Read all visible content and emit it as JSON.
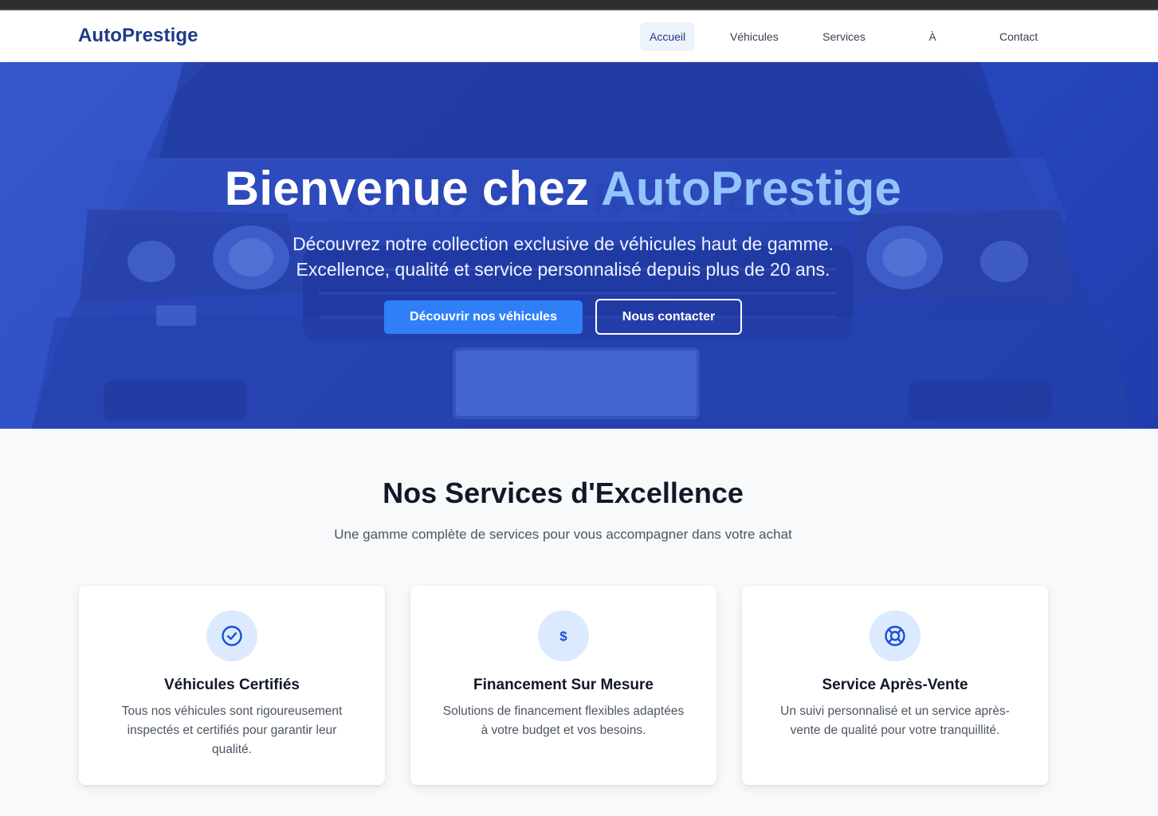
{
  "nav": {
    "brand": "AutoPrestige",
    "items": [
      {
        "label": "Accueil",
        "active": true
      },
      {
        "label": "Véhicules",
        "active": false
      },
      {
        "label": "Services",
        "active": false
      },
      {
        "label": "À propos",
        "active": false
      },
      {
        "label": "Contact",
        "active": false
      }
    ]
  },
  "hero": {
    "title_prefix": "Bienvenue chez ",
    "title_accent": "AutoPrestige",
    "subtitle_line1": "Découvrez notre collection exclusive de véhicules haut de gamme.",
    "subtitle_line2": "Excellence, qualité et service personnalisé depuis plus de 20 ans.",
    "primary_button": "Découvrir nos véhicules",
    "secondary_button": "Nous contacter"
  },
  "services": {
    "title": "Nos Services d'Excellence",
    "subtitle": "Une gamme complète de services pour vous accompagner dans votre achat",
    "cards": [
      {
        "icon": "check-circle-icon",
        "title": "Véhicules Certifiés",
        "text": "Tous nos véhicules sont rigoureusement inspectés et certifiés pour garantir leur qualité."
      },
      {
        "icon": "dollar-icon",
        "title": "Financement Sur Mesure",
        "text": "Solutions de financement flexibles adaptées à votre budget et vos besoins."
      },
      {
        "icon": "lifebuoy-icon",
        "title": "Service Après-Vente",
        "text": "Un suivi personnalisé et un service après-vente de qualité pour votre tranquillité."
      }
    ]
  },
  "colors": {
    "brand": "#1e3a8a",
    "accent": "#2f80f6",
    "hero_accent_text": "#93c5fd",
    "icon_bg": "#dbeafe"
  }
}
